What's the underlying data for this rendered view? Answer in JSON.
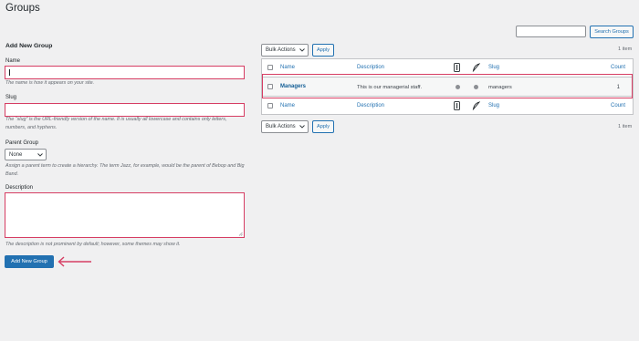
{
  "page": {
    "title": "Groups"
  },
  "search": {
    "placeholder": "",
    "button_label": "Search Groups"
  },
  "form": {
    "heading": "Add New Group",
    "name": {
      "label": "Name",
      "value": "",
      "hint": "The name is how it appears on your site."
    },
    "slug": {
      "label": "Slug",
      "value": "",
      "hint": "The “slug” is the URL-friendly version of the name. It is usually all lowercase and contains only letters, numbers, and hyphens."
    },
    "parent": {
      "label": "Parent Group",
      "selected": "None",
      "hint": "Assign a parent term to create a hierarchy. The term Jazz, for example, would be the parent of Bebop and Big Band."
    },
    "description": {
      "label": "Description",
      "value": "",
      "hint": "The description is not prominent by default; however, some themes may show it."
    },
    "submit_label": "Add New Group"
  },
  "list": {
    "bulk_actions_label": "Bulk Actions",
    "apply_label": "Apply",
    "items_count": "1 item",
    "columns": {
      "name": "Name",
      "description": "Description",
      "slug": "Slug",
      "count": "Count"
    },
    "rows": [
      {
        "name": "Managers",
        "description": "This is our managerial staff.",
        "slug": "managers",
        "count": "1"
      }
    ]
  },
  "colors": {
    "accent": "#2271b1",
    "highlight": "#d63d63",
    "background": "#f0f0f1"
  }
}
